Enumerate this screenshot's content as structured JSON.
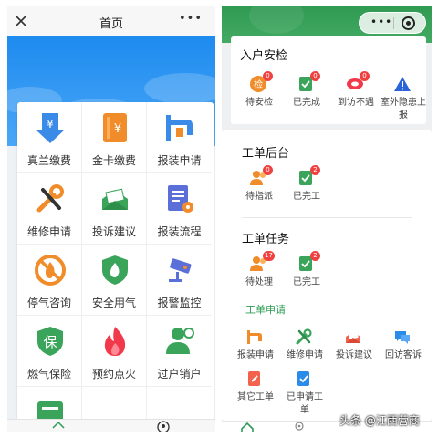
{
  "left": {
    "nav": {
      "title": "首页",
      "more": "•••"
    },
    "grid": [
      {
        "label": "真兰缴费",
        "icon": "yuan-download-icon"
      },
      {
        "label": "金卡缴费",
        "icon": "yuan-card-icon"
      },
      {
        "label": "报装申请",
        "icon": "faucet-icon"
      },
      {
        "label": "维修申请",
        "icon": "wrench-icon"
      },
      {
        "label": "投诉建议",
        "icon": "envelope-icon"
      },
      {
        "label": "报装流程",
        "icon": "form-gear-icon"
      },
      {
        "label": "停气咨询",
        "icon": "no-flame-icon"
      },
      {
        "label": "安全用气",
        "icon": "shield-flame-icon"
      },
      {
        "label": "报警监控",
        "icon": "camera-icon"
      },
      {
        "label": "燃气保险",
        "icon": "insurance-icon"
      },
      {
        "label": "预约点火",
        "icon": "fire-icon"
      },
      {
        "label": "过户销户",
        "icon": "user-transfer-icon"
      }
    ]
  },
  "right": {
    "capsule": {
      "dots": "•••"
    },
    "inspection": {
      "title": "入户安检",
      "items": [
        {
          "label": "待安检",
          "badge": "0",
          "icon_text": "检"
        },
        {
          "label": "已完成",
          "badge": "0"
        },
        {
          "label": "到访不遇",
          "badge": "0"
        },
        {
          "label": "室外隐患上报",
          "label_line1": "室外隐患上",
          "label_line2": "报"
        }
      ]
    },
    "backend": {
      "title": "工单后台",
      "items": [
        {
          "label": "待指派",
          "badge": "0"
        },
        {
          "label": "已完工",
          "badge": "2"
        }
      ]
    },
    "tasks": {
      "title": "工单任务",
      "items": [
        {
          "label": "待处理",
          "badge": "17"
        },
        {
          "label": "已完工",
          "badge": "2"
        }
      ]
    },
    "apply": {
      "title": "工单申请",
      "items": [
        {
          "label": "报装申请"
        },
        {
          "label": "维修申请"
        },
        {
          "label": "投诉建议"
        },
        {
          "label": "回访客诉"
        },
        {
          "label": "其它工单"
        },
        {
          "label": "已申请工单",
          "label_line1": "已申请工",
          "label_line2": "单"
        }
      ]
    }
  },
  "watermark": "头条 @江西营商",
  "colors": {
    "accent_blue": "#1e8bef",
    "accent_green": "#2d9c55",
    "badge_red": "#f04141",
    "orange": "#f08c2a"
  }
}
